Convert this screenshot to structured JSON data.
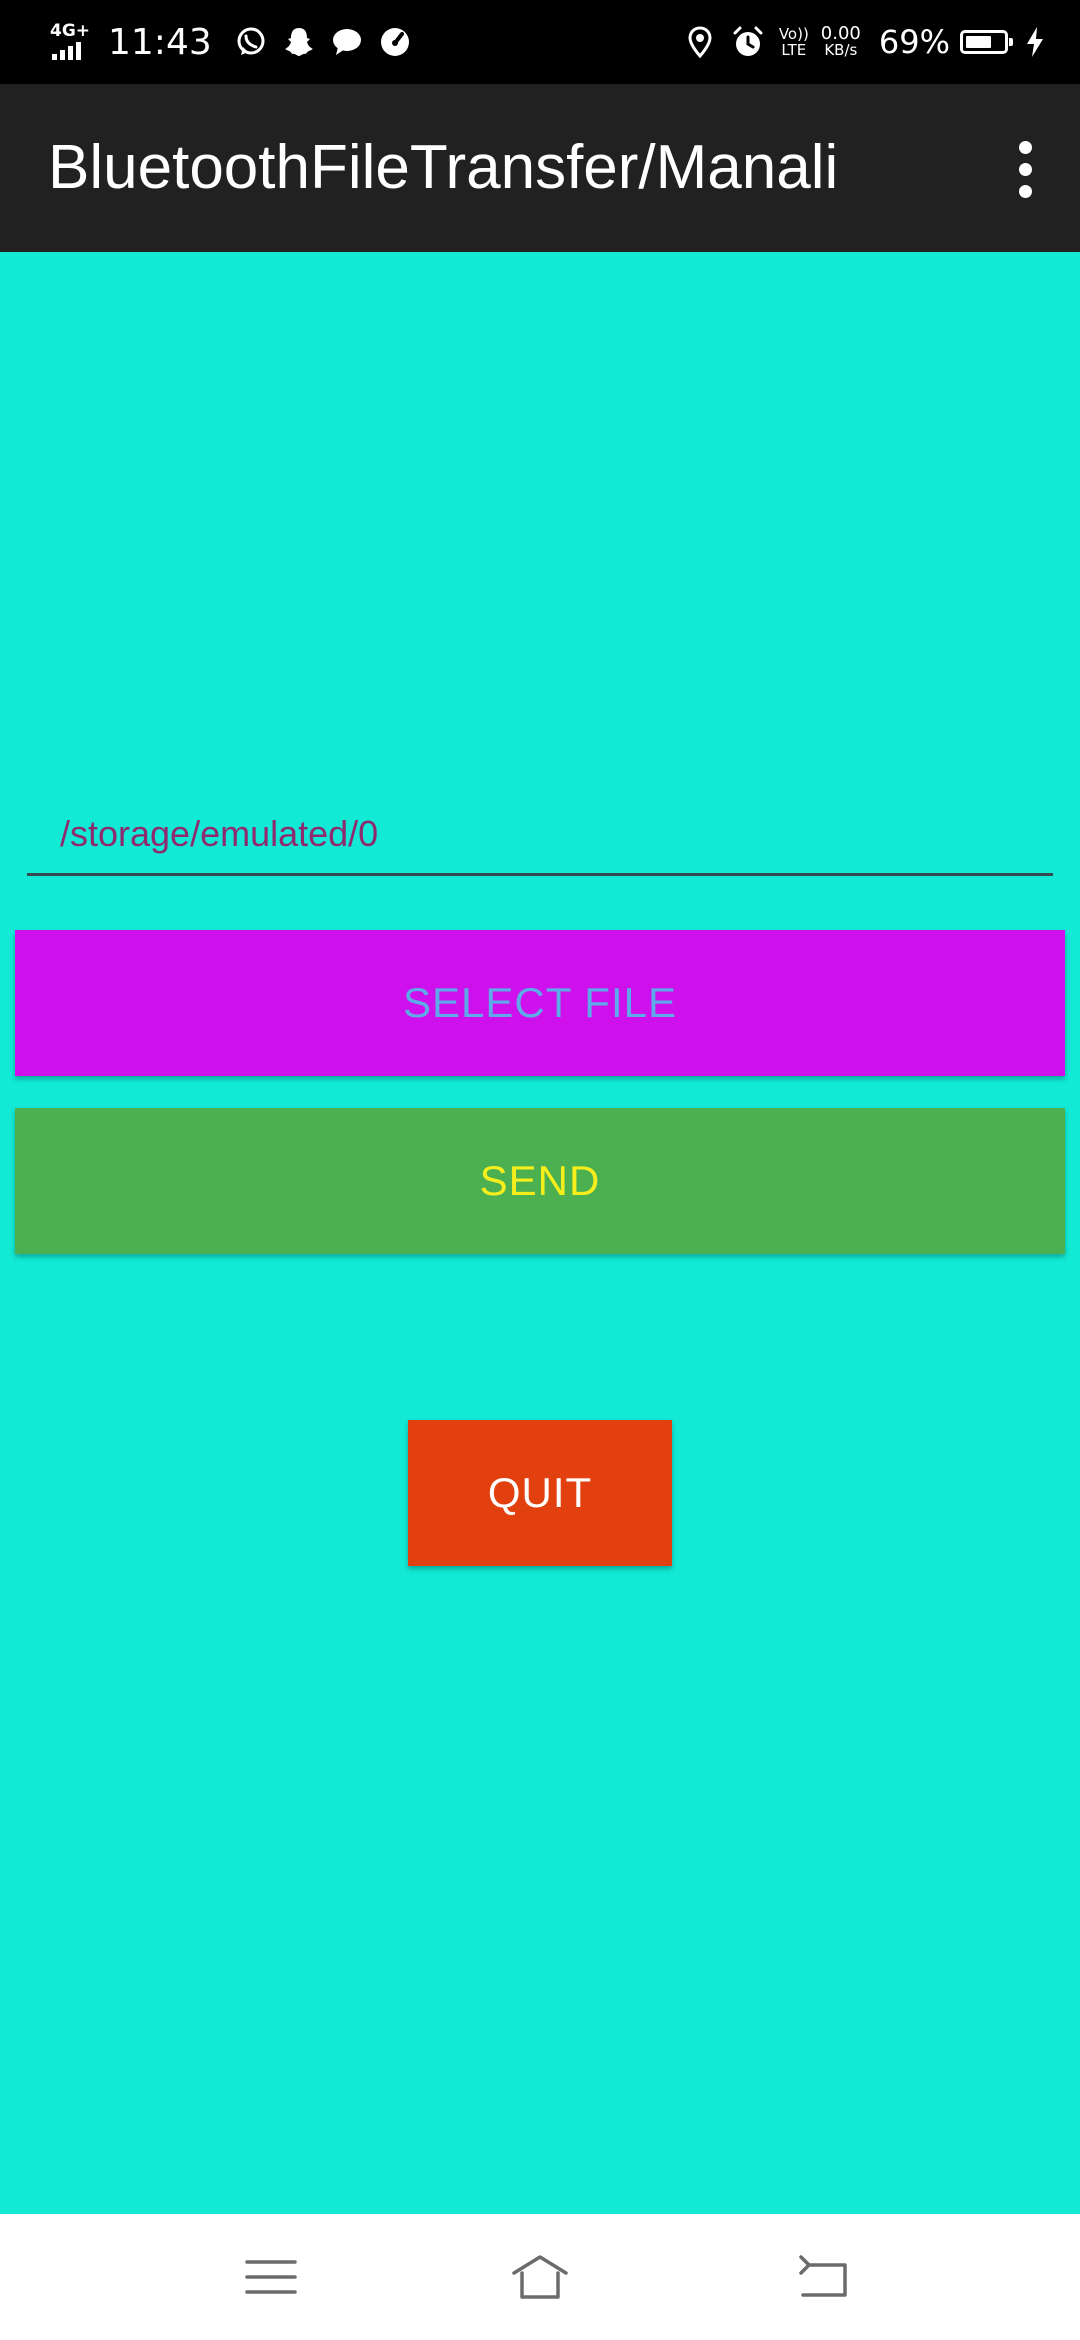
{
  "status_bar": {
    "network": "4G+",
    "time": "11:43",
    "notification_icons": [
      "whatsapp-icon",
      "snapchat-icon",
      "chat-bubble-icon",
      "speedometer-icon"
    ],
    "system_icons": [
      "location-icon",
      "alarm-icon",
      "volte-icon"
    ],
    "volte_line1": "Vo))",
    "volte_line2": "LTE",
    "speed_value": "0.00",
    "speed_unit": "KB/s",
    "battery_percent": "69%",
    "battery_level": 0.69,
    "charging": true
  },
  "app_bar": {
    "title": "BluetoothFileTransfer/Manali",
    "overflow_icon": "more-vert-icon"
  },
  "main": {
    "path_value": "/storage/emulated/0",
    "select_file_label": "SELECT FILE",
    "send_label": "SEND",
    "quit_label": "QUIT"
  },
  "nav_bar": {
    "icons": [
      "menu-icon",
      "home-icon",
      "back-icon"
    ]
  },
  "colors": {
    "background": "#12EAD6",
    "app_bar": "#212121",
    "select_button": "#CE10EC",
    "select_text": "#5EA9E8",
    "send_button": "#4CAF50",
    "send_text": "#F5EE1C",
    "quit_button": "#E2400E",
    "path_text": "#8E2B6F"
  }
}
